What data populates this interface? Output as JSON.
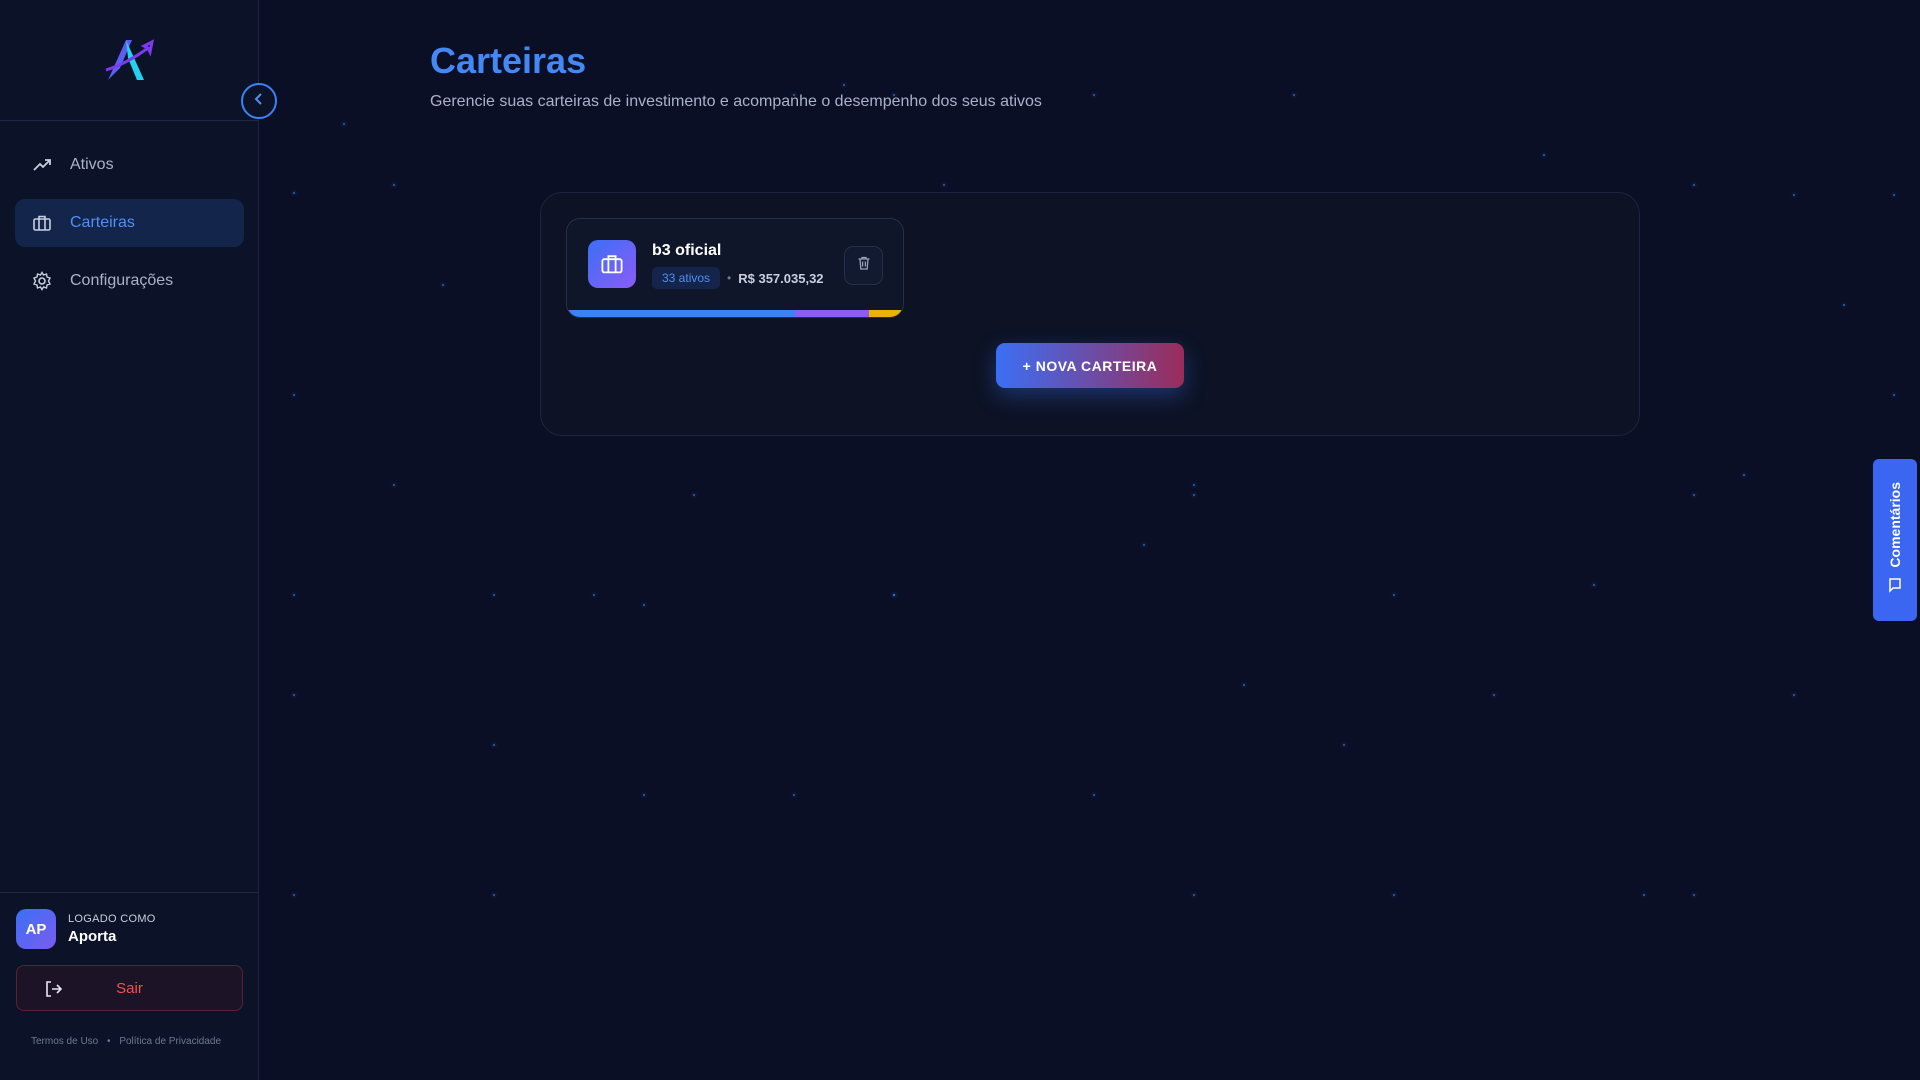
{
  "sidebar": {
    "logo": "aporta-logo",
    "nav": [
      {
        "label": "Ativos",
        "icon": "trending-up-icon",
        "active": false
      },
      {
        "label": "Carteiras",
        "icon": "briefcase-icon",
        "active": true
      },
      {
        "label": "Configurações",
        "icon": "gear-icon",
        "active": false
      }
    ],
    "user": {
      "initials": "AP",
      "caption": "LOGADO COMO",
      "name": "Aporta"
    },
    "logout_label": "Sair",
    "footer": {
      "terms": "Termos de Uso",
      "separator": "•",
      "privacy": "Política de Privacidade"
    }
  },
  "main": {
    "title": "Carteiras",
    "subtitle": "Gerencie suas carteiras de investimento e acompanhe o desempenho dos seus ativos",
    "wallets": [
      {
        "name": "b3 oficial",
        "assets_badge": "33 ativos",
        "separator": "•",
        "value": "R$ 357.035,32",
        "allocation": [
          {
            "color": "#3b82f6",
            "fraction": 0.68
          },
          {
            "color": "#8b5cf6",
            "fraction": 0.22
          },
          {
            "color": "#eab308",
            "fraction": 0.1
          }
        ]
      }
    ],
    "new_wallet_label": "+ NOVA CARTEIRA"
  },
  "feedback": {
    "label": "Comentários",
    "icon": "message-icon"
  },
  "colors": {
    "accent": "#4488f5",
    "background": "#0a0f26",
    "danger": "#f05252"
  }
}
